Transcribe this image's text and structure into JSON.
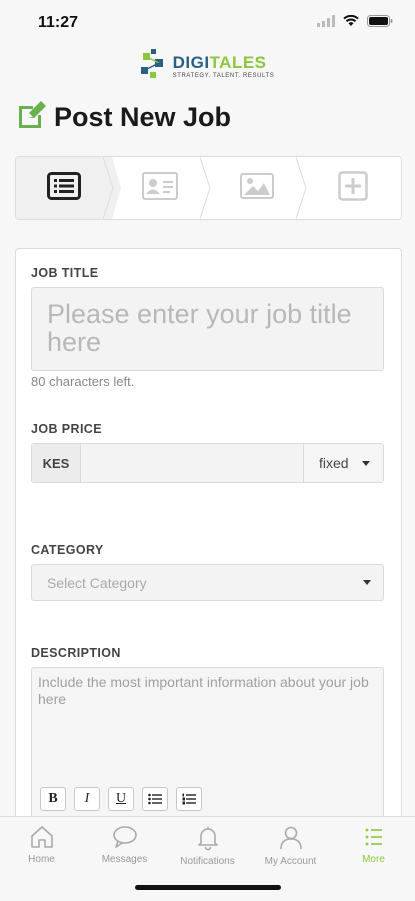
{
  "status": {
    "time": "11:27"
  },
  "logo": {
    "name_part1": "DIGI",
    "name_part2": "TALES",
    "tagline": "STRATEGY. TALENT. RESULTS"
  },
  "page": {
    "title": "Post New Job"
  },
  "steps": [
    {
      "name": "details",
      "icon": "list-icon",
      "active": true
    },
    {
      "name": "contact",
      "icon": "id-card-icon",
      "active": false
    },
    {
      "name": "images",
      "icon": "image-icon",
      "active": false
    },
    {
      "name": "extras",
      "icon": "plus-square-icon",
      "active": false
    }
  ],
  "form": {
    "job_title": {
      "label": "JOB TITLE",
      "placeholder": "Please enter your job title here",
      "hint": "80 characters left."
    },
    "job_price": {
      "label": "JOB PRICE",
      "currency": "KES",
      "value": "",
      "type": "fixed"
    },
    "category": {
      "label": "CATEGORY",
      "placeholder": "Select Category"
    },
    "description": {
      "label": "DESCRIPTION",
      "placeholder": "Include the most important information about your job here"
    },
    "toolbar": {
      "bold": "B",
      "italic": "I",
      "underline": "U"
    }
  },
  "tabs": [
    {
      "label": "Home",
      "icon": "home-icon"
    },
    {
      "label": "Messages",
      "icon": "chat-icon"
    },
    {
      "label": "Notifications",
      "icon": "bell-icon"
    },
    {
      "label": "My Account",
      "icon": "user-icon"
    },
    {
      "label": "More",
      "icon": "more-list-icon"
    }
  ],
  "colors": {
    "accent": "#8dc63f",
    "brand_blue": "#2a5f86"
  }
}
